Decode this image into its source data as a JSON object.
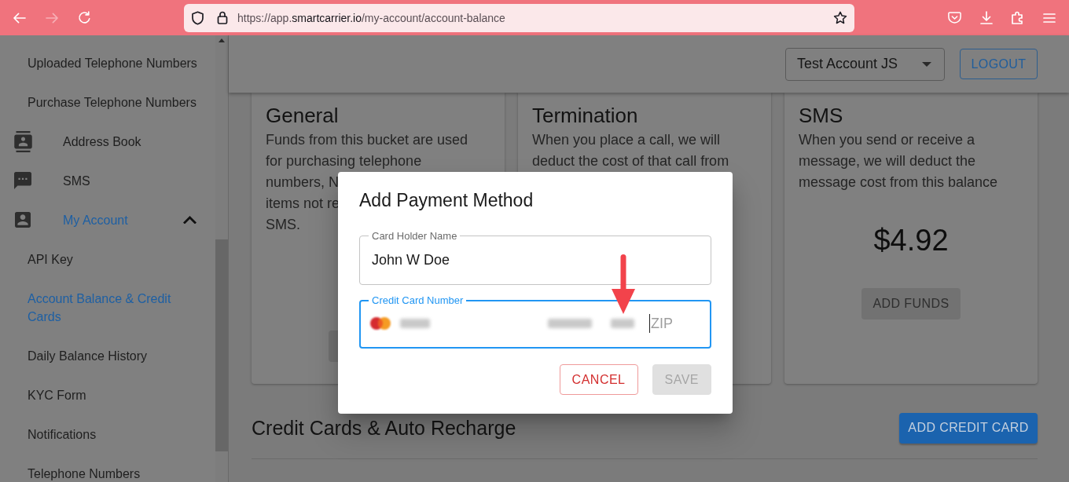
{
  "browser": {
    "url": "https://app.**smartcarrier.io**/my-account/account-balance",
    "back_disabled": false,
    "forward_disabled": true
  },
  "sidebar": {
    "items": [
      {
        "label": "Uploaded Telephone Numbers",
        "kind": "link",
        "selected": false
      },
      {
        "label": "Purchase Telephone Numbers",
        "kind": "link",
        "selected": false
      },
      {
        "label": "Address Book",
        "kind": "section",
        "selected": false
      },
      {
        "label": "SMS",
        "kind": "section",
        "selected": false
      },
      {
        "label": "My Account",
        "kind": "section",
        "selected": true,
        "expanded": true,
        "children": [
          {
            "label": "API Key",
            "kind": "link",
            "selected": false
          },
          {
            "label": "Account Balance & Credit Cards",
            "kind": "link",
            "selected": true
          },
          {
            "label": "Daily Balance History",
            "kind": "link",
            "selected": false
          },
          {
            "label": "KYC Form",
            "kind": "link",
            "selected": false
          },
          {
            "label": "Notifications",
            "kind": "link",
            "selected": false
          },
          {
            "label": "Telephone Numbers",
            "kind": "link",
            "selected": false
          }
        ]
      }
    ]
  },
  "header": {
    "account_select": {
      "value": "Test Account JS"
    },
    "logout_button": "LOGOUT"
  },
  "balance_cards": [
    {
      "title": "General",
      "description_lines": [
        "Funds from this bucket are used",
        "for purchasing telephone",
        "numbers, N",
        "items not re",
        "SMS."
      ],
      "button": {
        "disabled": true
      }
    },
    {
      "title": "Termination",
      "description_lines": [
        "When you place a call, we will",
        "deduct the cost of that call from"
      ]
    },
    {
      "title": "SMS",
      "description": "When you send or receive a message, we will deduct the message cost from this balance",
      "amount": "$4.92",
      "button": {
        "label": "ADD FUNDS",
        "disabled": true
      }
    }
  ],
  "credit_cards_section": {
    "title": "Credit Cards & Auto Recharge",
    "add_button": "ADD CREDIT CARD"
  },
  "dialog": {
    "title": "Add Payment Method",
    "fields": [
      {
        "kind": "text",
        "label": "Card Holder Name",
        "value": "John W Doe",
        "focused": false
      },
      {
        "kind": "card",
        "label": "Credit Card Number",
        "zip_placeholder": "ZIP",
        "focused": true
      }
    ],
    "buttons": [
      {
        "label": "CANCEL",
        "kind": "outlined",
        "disabled": false
      },
      {
        "label": "SAVE",
        "kind": "contained",
        "disabled": true
      }
    ]
  }
}
